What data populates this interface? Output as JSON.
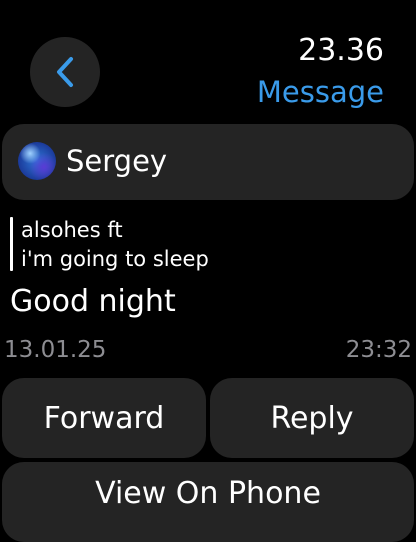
{
  "header": {
    "back_icon": "chevron-left-icon",
    "time": "23.36",
    "title": "Message",
    "accent_color": "#3a9bea"
  },
  "sender": {
    "name": "Sergey",
    "avatar_icon": "avatar-image"
  },
  "quote": {
    "author": "alsohes ft",
    "text": "i'm going to sleep"
  },
  "message": {
    "text": "Good night",
    "date": "13.01.25",
    "time": "23:32"
  },
  "actions": {
    "forward_label": "Forward",
    "reply_label": "Reply",
    "view_on_phone_label": "View On Phone"
  }
}
